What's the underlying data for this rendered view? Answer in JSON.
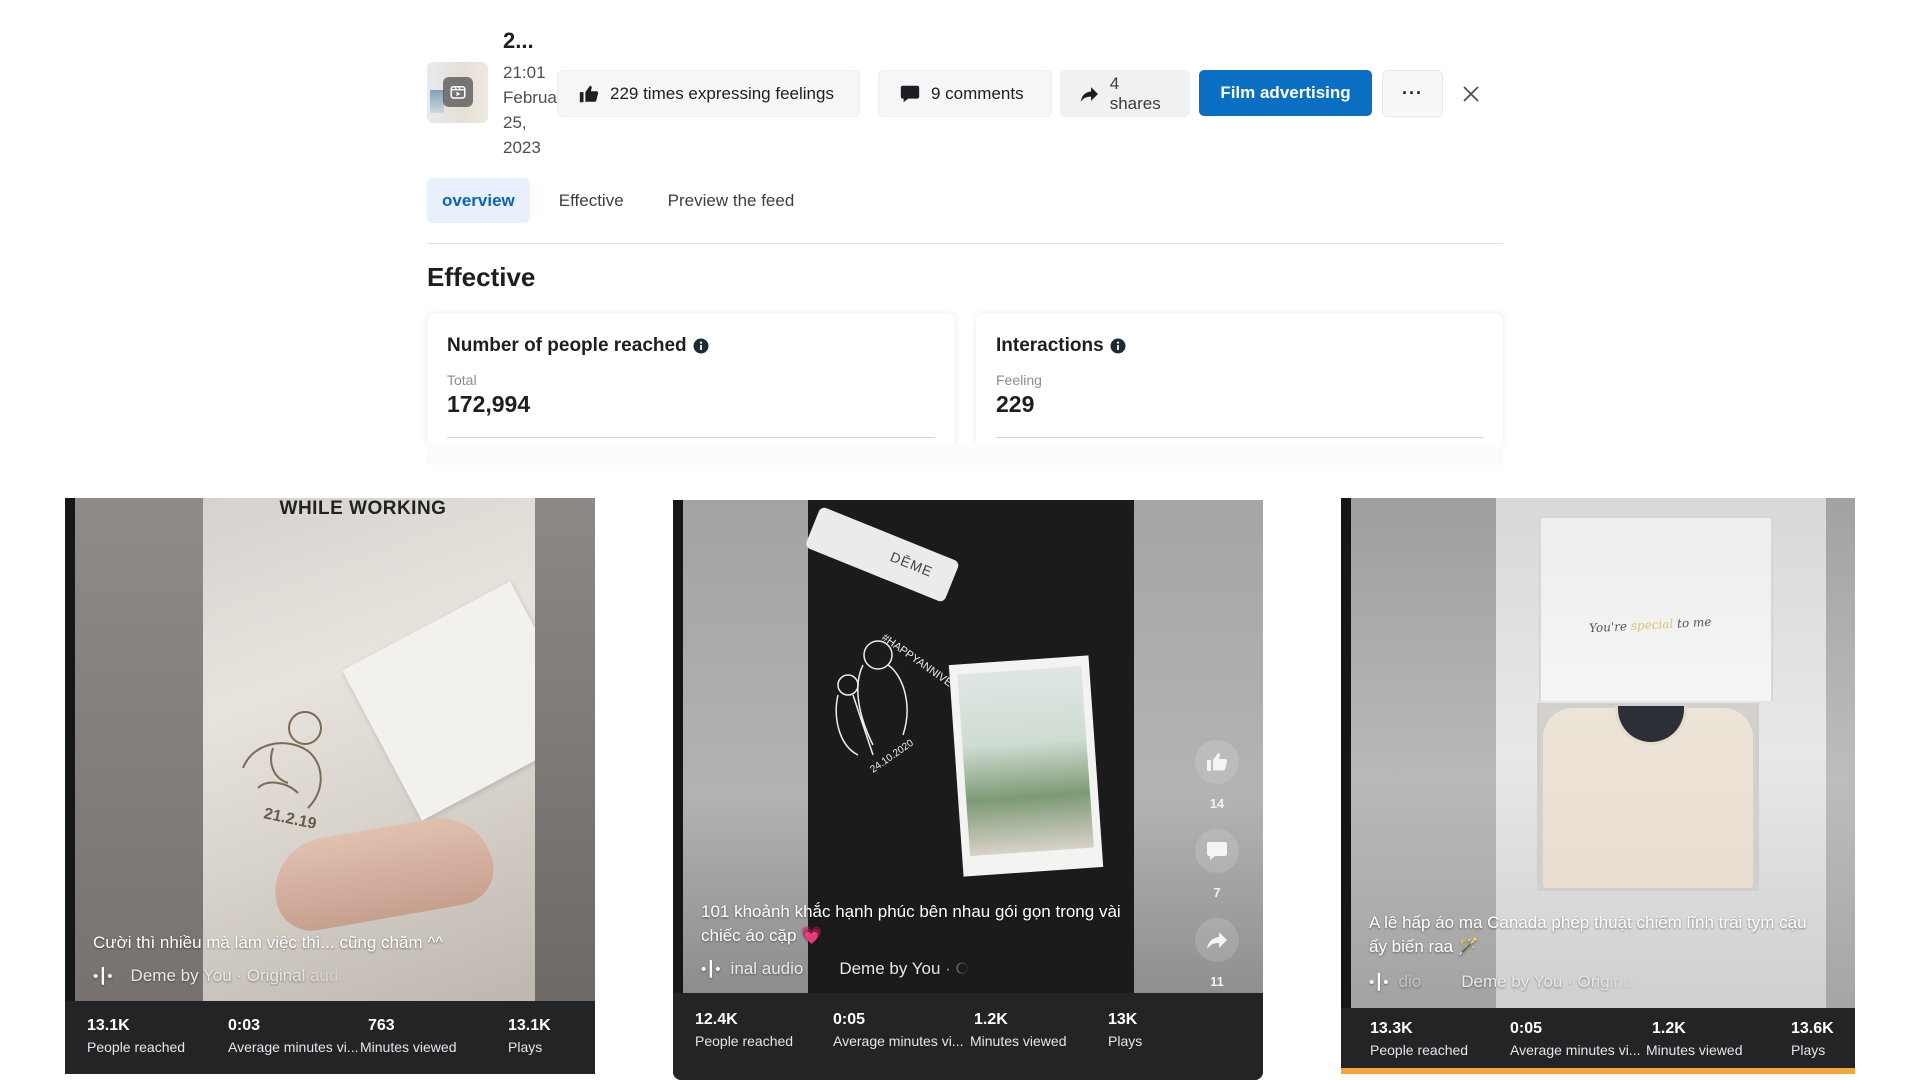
{
  "post": {
    "title": "2...",
    "date_lines": [
      "21:01",
      "Februa",
      "25,",
      "2023"
    ],
    "likes_chip": "229 times expressing feelings",
    "comments_chip": "9 comments",
    "shares_chip": "4 shares",
    "primary_button": "Film advertising",
    "more_button": "···"
  },
  "tabs": [
    {
      "label": "overview",
      "active": true
    },
    {
      "label": "Effective",
      "active": false
    },
    {
      "label": "Preview the feed",
      "active": false
    }
  ],
  "section_title": "Effective",
  "metrics": {
    "reach": {
      "title": "Number of people reached",
      "label": "Total",
      "value": "172,994"
    },
    "interactions": {
      "title": "Interactions",
      "label": "Feeling",
      "value": "229"
    }
  },
  "videos": [
    {
      "overlay_text": "WHILE WORKING",
      "caption": "Cười thì nhiều mà làm việc thì... cũng chăm ^^",
      "audio_prefix": "",
      "audio": "Deme by You · Original audio",
      "stats": [
        {
          "value": "13.1K",
          "label": "People reached"
        },
        {
          "value": "0:03",
          "label": "Average minutes vi..."
        },
        {
          "value": "763",
          "label": "Minutes viewed"
        },
        {
          "value": "13.1K",
          "label": "Plays"
        }
      ]
    },
    {
      "tag_text": "DĒME",
      "caption_line1": "101 khoảnh khắc hạnh phúc bên nhau gói gọn trong vài",
      "caption_line2": "chiếc áo cặp 💗",
      "audio_prefix": "inal audio",
      "audio": "Deme by You · O",
      "actions": {
        "likes": "14",
        "comments": "7",
        "shares": "11"
      },
      "stats": [
        {
          "value": "12.4K",
          "label": "People reached"
        },
        {
          "value": "0:05",
          "label": "Average minutes vi..."
        },
        {
          "value": "1.2K",
          "label": "Minutes viewed"
        },
        {
          "value": "13K",
          "label": "Plays"
        }
      ]
    },
    {
      "lid_text_a": "You're ",
      "lid_text_b": "special",
      "lid_text_c": " to me",
      "caption_line1": "A lê hấp áo ma Canada phép thuật chiếm lĩnh trái tym cậu",
      "caption_line2": "ấy biến raa 🪄",
      "audio_prefix": "dio",
      "audio": "Deme by You · Original",
      "stats": [
        {
          "value": "13.3K",
          "label": "People reached"
        },
        {
          "value": "0:05",
          "label": "Average minutes vi..."
        },
        {
          "value": "1.2K",
          "label": "Minutes viewed"
        },
        {
          "value": "13.6K",
          "label": "Plays"
        }
      ]
    }
  ]
}
